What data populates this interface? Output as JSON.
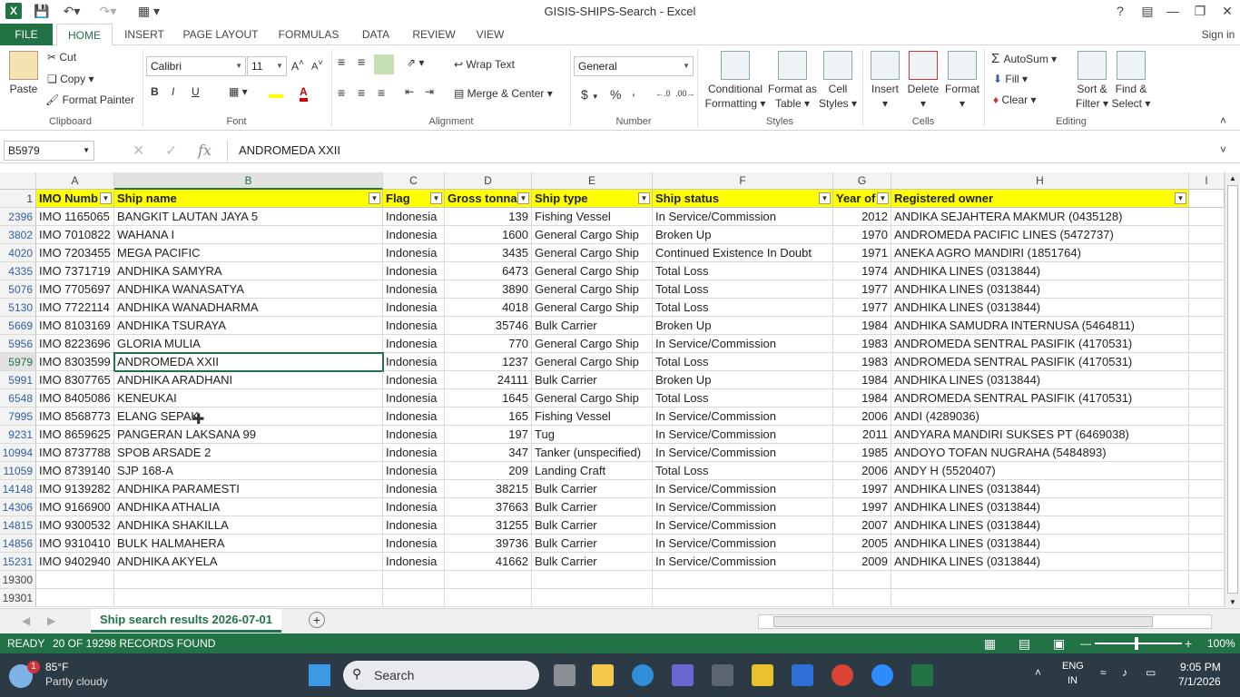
{
  "window": {
    "title": "GISIS-SHIPS-Search - Excel",
    "help": "?",
    "signin": "Sign in"
  },
  "tabs": [
    "FILE",
    "HOME",
    "INSERT",
    "PAGE LAYOUT",
    "FORMULAS",
    "DATA",
    "REVIEW",
    "VIEW"
  ],
  "ribbon": {
    "clipboard": {
      "paste": "Paste",
      "cut": "Cut",
      "copy": "Copy",
      "format_painter": "Format Painter",
      "label": "Clipboard"
    },
    "font": {
      "name": "Calibri",
      "size": "11",
      "bold": "B",
      "italic": "I",
      "underline": "U",
      "label": "Font"
    },
    "alignment": {
      "wrap": "Wrap Text",
      "merge": "Merge & Center",
      "label": "Alignment"
    },
    "number": {
      "format": "General",
      "currency": "$",
      "percent": "%",
      "comma": ",",
      "label": "Number"
    },
    "styles": {
      "conditional": "Conditional",
      "conditional2": "Formatting",
      "format_table": "Format as",
      "format_table2": "Table",
      "cell_styles": "Cell",
      "cell_styles2": "Styles",
      "label": "Styles"
    },
    "cells": {
      "insert": "Insert",
      "delete": "Delete",
      "format": "Format",
      "label": "Cells"
    },
    "editing": {
      "autosum": "AutoSum",
      "fill": "Fill",
      "clear": "Clear",
      "sort": "Sort &",
      "sort2": "Filter",
      "find": "Find &",
      "find2": "Select",
      "label": "Editing"
    }
  },
  "formula_bar": {
    "name_box": "B5979",
    "fx": "fx",
    "value": "ANDROMEDA XXII"
  },
  "columns": [
    "A",
    "B",
    "C",
    "D",
    "E",
    "F",
    "G",
    "H",
    "I"
  ],
  "header_row": {
    "num": "1",
    "cells": [
      "IMO Numb",
      "Ship name",
      "Flag",
      "Gross tonna",
      "Ship type",
      "Ship status",
      "Year of",
      "Registered owner"
    ]
  },
  "rows": [
    {
      "r": "2396",
      "c": [
        "IMO 1165065",
        "BANGKIT LAUTAN JAYA 5",
        "Indonesia",
        "139",
        "Fishing Vessel",
        "In Service/Commission",
        "2012",
        "ANDIKA SEJAHTERA MAKMUR (0435128)"
      ]
    },
    {
      "r": "3802",
      "c": [
        "IMO 7010822",
        "WAHANA I",
        "Indonesia",
        "1600",
        "General Cargo Ship",
        "Broken Up",
        "1970",
        "ANDROMEDA PACIFIC LINES (5472737)"
      ]
    },
    {
      "r": "4020",
      "c": [
        "IMO 7203455",
        "MEGA PACIFIC",
        "Indonesia",
        "3435",
        "General Cargo Ship",
        "Continued Existence In Doubt",
        "1971",
        "ANEKA AGRO MANDIRI (1851764)"
      ]
    },
    {
      "r": "4335",
      "c": [
        "IMO 7371719",
        "ANDHIKA SAMYRA",
        "Indonesia",
        "6473",
        "General Cargo Ship",
        "Total Loss",
        "1974",
        "ANDHIKA LINES (0313844)"
      ]
    },
    {
      "r": "5076",
      "c": [
        "IMO 7705697",
        "ANDHIKA WANASATYA",
        "Indonesia",
        "3890",
        "General Cargo Ship",
        "Total Loss",
        "1977",
        "ANDHIKA LINES (0313844)"
      ]
    },
    {
      "r": "5130",
      "c": [
        "IMO 7722114",
        "ANDHIKA WANADHARMA",
        "Indonesia",
        "4018",
        "General Cargo Ship",
        "Total Loss",
        "1977",
        "ANDHIKA LINES (0313844)"
      ]
    },
    {
      "r": "5669",
      "c": [
        "IMO 8103169",
        "ANDHIKA TSURAYA",
        "Indonesia",
        "35746",
        "Bulk Carrier",
        "Broken Up",
        "1984",
        "ANDHIKA SAMUDRA INTERNUSA (5464811)"
      ]
    },
    {
      "r": "5956",
      "c": [
        "IMO 8223696",
        "GLORIA MULIA",
        "Indonesia",
        "770",
        "General Cargo Ship",
        "In Service/Commission",
        "1983",
        "ANDROMEDA SENTRAL PASIFIK (4170531)"
      ]
    },
    {
      "r": "5979",
      "c": [
        "IMO 8303599",
        "ANDROMEDA XXII",
        "Indonesia",
        "1237",
        "General Cargo Ship",
        "Total Loss",
        "1983",
        "ANDROMEDA SENTRAL PASIFIK (4170531)"
      ]
    },
    {
      "r": "5991",
      "c": [
        "IMO 8307765",
        "ANDHIKA ARADHANI",
        "Indonesia",
        "24111",
        "Bulk Carrier",
        "Broken Up",
        "1984",
        "ANDHIKA LINES (0313844)"
      ]
    },
    {
      "r": "6548",
      "c": [
        "IMO 8405086",
        "KENEUKAI",
        "Indonesia",
        "1645",
        "General Cargo Ship",
        "Total Loss",
        "1984",
        "ANDROMEDA SENTRAL PASIFIK (4170531)"
      ]
    },
    {
      "r": "7995",
      "c": [
        "IMO 8568773",
        "ELANG SEPAK",
        "Indonesia",
        "165",
        "Fishing Vessel",
        "In Service/Commission",
        "2006",
        "ANDI (4289036)"
      ]
    },
    {
      "r": "9231",
      "c": [
        "IMO 8659625",
        "PANGERAN LAKSANA 99",
        "Indonesia",
        "197",
        "Tug",
        "In Service/Commission",
        "2011",
        "ANDYARA MANDIRI SUKSES PT (6469038)"
      ]
    },
    {
      "r": "10994",
      "c": [
        "IMO 8737788",
        "SPOB ARSADE 2",
        "Indonesia",
        "347",
        "Tanker (unspecified)",
        "In Service/Commission",
        "1985",
        "ANDOYO TOFAN NUGRAHA (5484893)"
      ]
    },
    {
      "r": "11059",
      "c": [
        "IMO 8739140",
        "SJP 168-A",
        "Indonesia",
        "209",
        "Landing Craft",
        "Total Loss",
        "2006",
        "ANDY H (5520407)"
      ]
    },
    {
      "r": "14148",
      "c": [
        "IMO 9139282",
        "ANDHIKA PARAMESTI",
        "Indonesia",
        "38215",
        "Bulk Carrier",
        "In Service/Commission",
        "1997",
        "ANDHIKA LINES (0313844)"
      ]
    },
    {
      "r": "14306",
      "c": [
        "IMO 9166900",
        "ANDHIKA ATHALIA",
        "Indonesia",
        "37663",
        "Bulk Carrier",
        "In Service/Commission",
        "1997",
        "ANDHIKA LINES (0313844)"
      ]
    },
    {
      "r": "14815",
      "c": [
        "IMO 9300532",
        "ANDHIKA SHAKILLA",
        "Indonesia",
        "31255",
        "Bulk Carrier",
        "In Service/Commission",
        "2007",
        "ANDHIKA LINES (0313844)"
      ]
    },
    {
      "r": "14856",
      "c": [
        "IMO 9310410",
        "BULK HALMAHERA",
        "Indonesia",
        "39736",
        "Bulk Carrier",
        "In Service/Commission",
        "2005",
        "ANDHIKA LINES (0313844)"
      ]
    },
    {
      "r": "15231",
      "c": [
        "IMO 9402940",
        "ANDHIKA AKYELA",
        "Indonesia",
        "41662",
        "Bulk Carrier",
        "In Service/Commission",
        "2009",
        "ANDHIKA LINES (0313844)"
      ]
    },
    {
      "r": "19300",
      "c": [
        "",
        "",
        "",
        "",
        "",
        "",
        "",
        ""
      ]
    },
    {
      "r": "19301",
      "c": [
        "",
        "",
        "",
        "",
        "",
        "",
        "",
        ""
      ]
    }
  ],
  "sheet_tab": "Ship search results 2026-07-01",
  "status": {
    "ready": "READY",
    "records": "20 OF 19298 RECORDS FOUND",
    "zoom": "100%"
  },
  "taskbar": {
    "temp": "85°F",
    "weather": "Partly cloudy",
    "search": "Search",
    "lang": "ENG",
    "lang2": "IN",
    "time": "9:05 PM",
    "date": "7/1/2026",
    "badge": "1"
  }
}
